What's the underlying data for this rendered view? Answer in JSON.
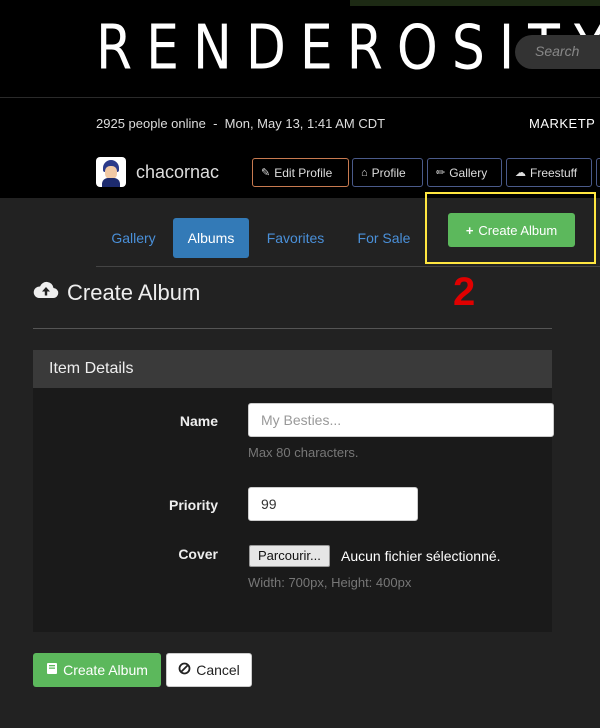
{
  "header": {
    "logo": "RENDEROSITY",
    "search_placeholder": "Search"
  },
  "subheader": {
    "online_text": "2925 people online  -  Mon, May 13, 1:41 AM CDT",
    "marketplace": "MARKETP",
    "username": "chacornac"
  },
  "nav_buttons": {
    "edit_profile": "Edit Profile",
    "profile": "Profile",
    "gallery": "Gallery",
    "freestuff": "Freestuff"
  },
  "tabs": {
    "gallery": "Gallery",
    "albums": "Albums",
    "favorites": "Favorites",
    "for_sale": "For Sale",
    "active": "Albums"
  },
  "create_button_top": "Create Album",
  "annotation": {
    "step_number": "2",
    "highlight_color": "#ffe640",
    "number_color": "#e00000"
  },
  "page": {
    "title": "Create Album"
  },
  "panel": {
    "heading": "Item Details",
    "name_label": "Name",
    "name_placeholder": "My Besties...",
    "name_help": "Max 80 characters.",
    "priority_label": "Priority",
    "priority_value": "99",
    "cover_label": "Cover",
    "file_button": "Parcourir...",
    "file_status": "Aucun fichier sélectionné.",
    "cover_help": "Width: 700px, Height: 400px"
  },
  "actions": {
    "create": "Create Album",
    "cancel": "Cancel"
  },
  "colors": {
    "accent_blue": "#337ab7",
    "success_green": "#5cb85c",
    "background": "#222222"
  }
}
